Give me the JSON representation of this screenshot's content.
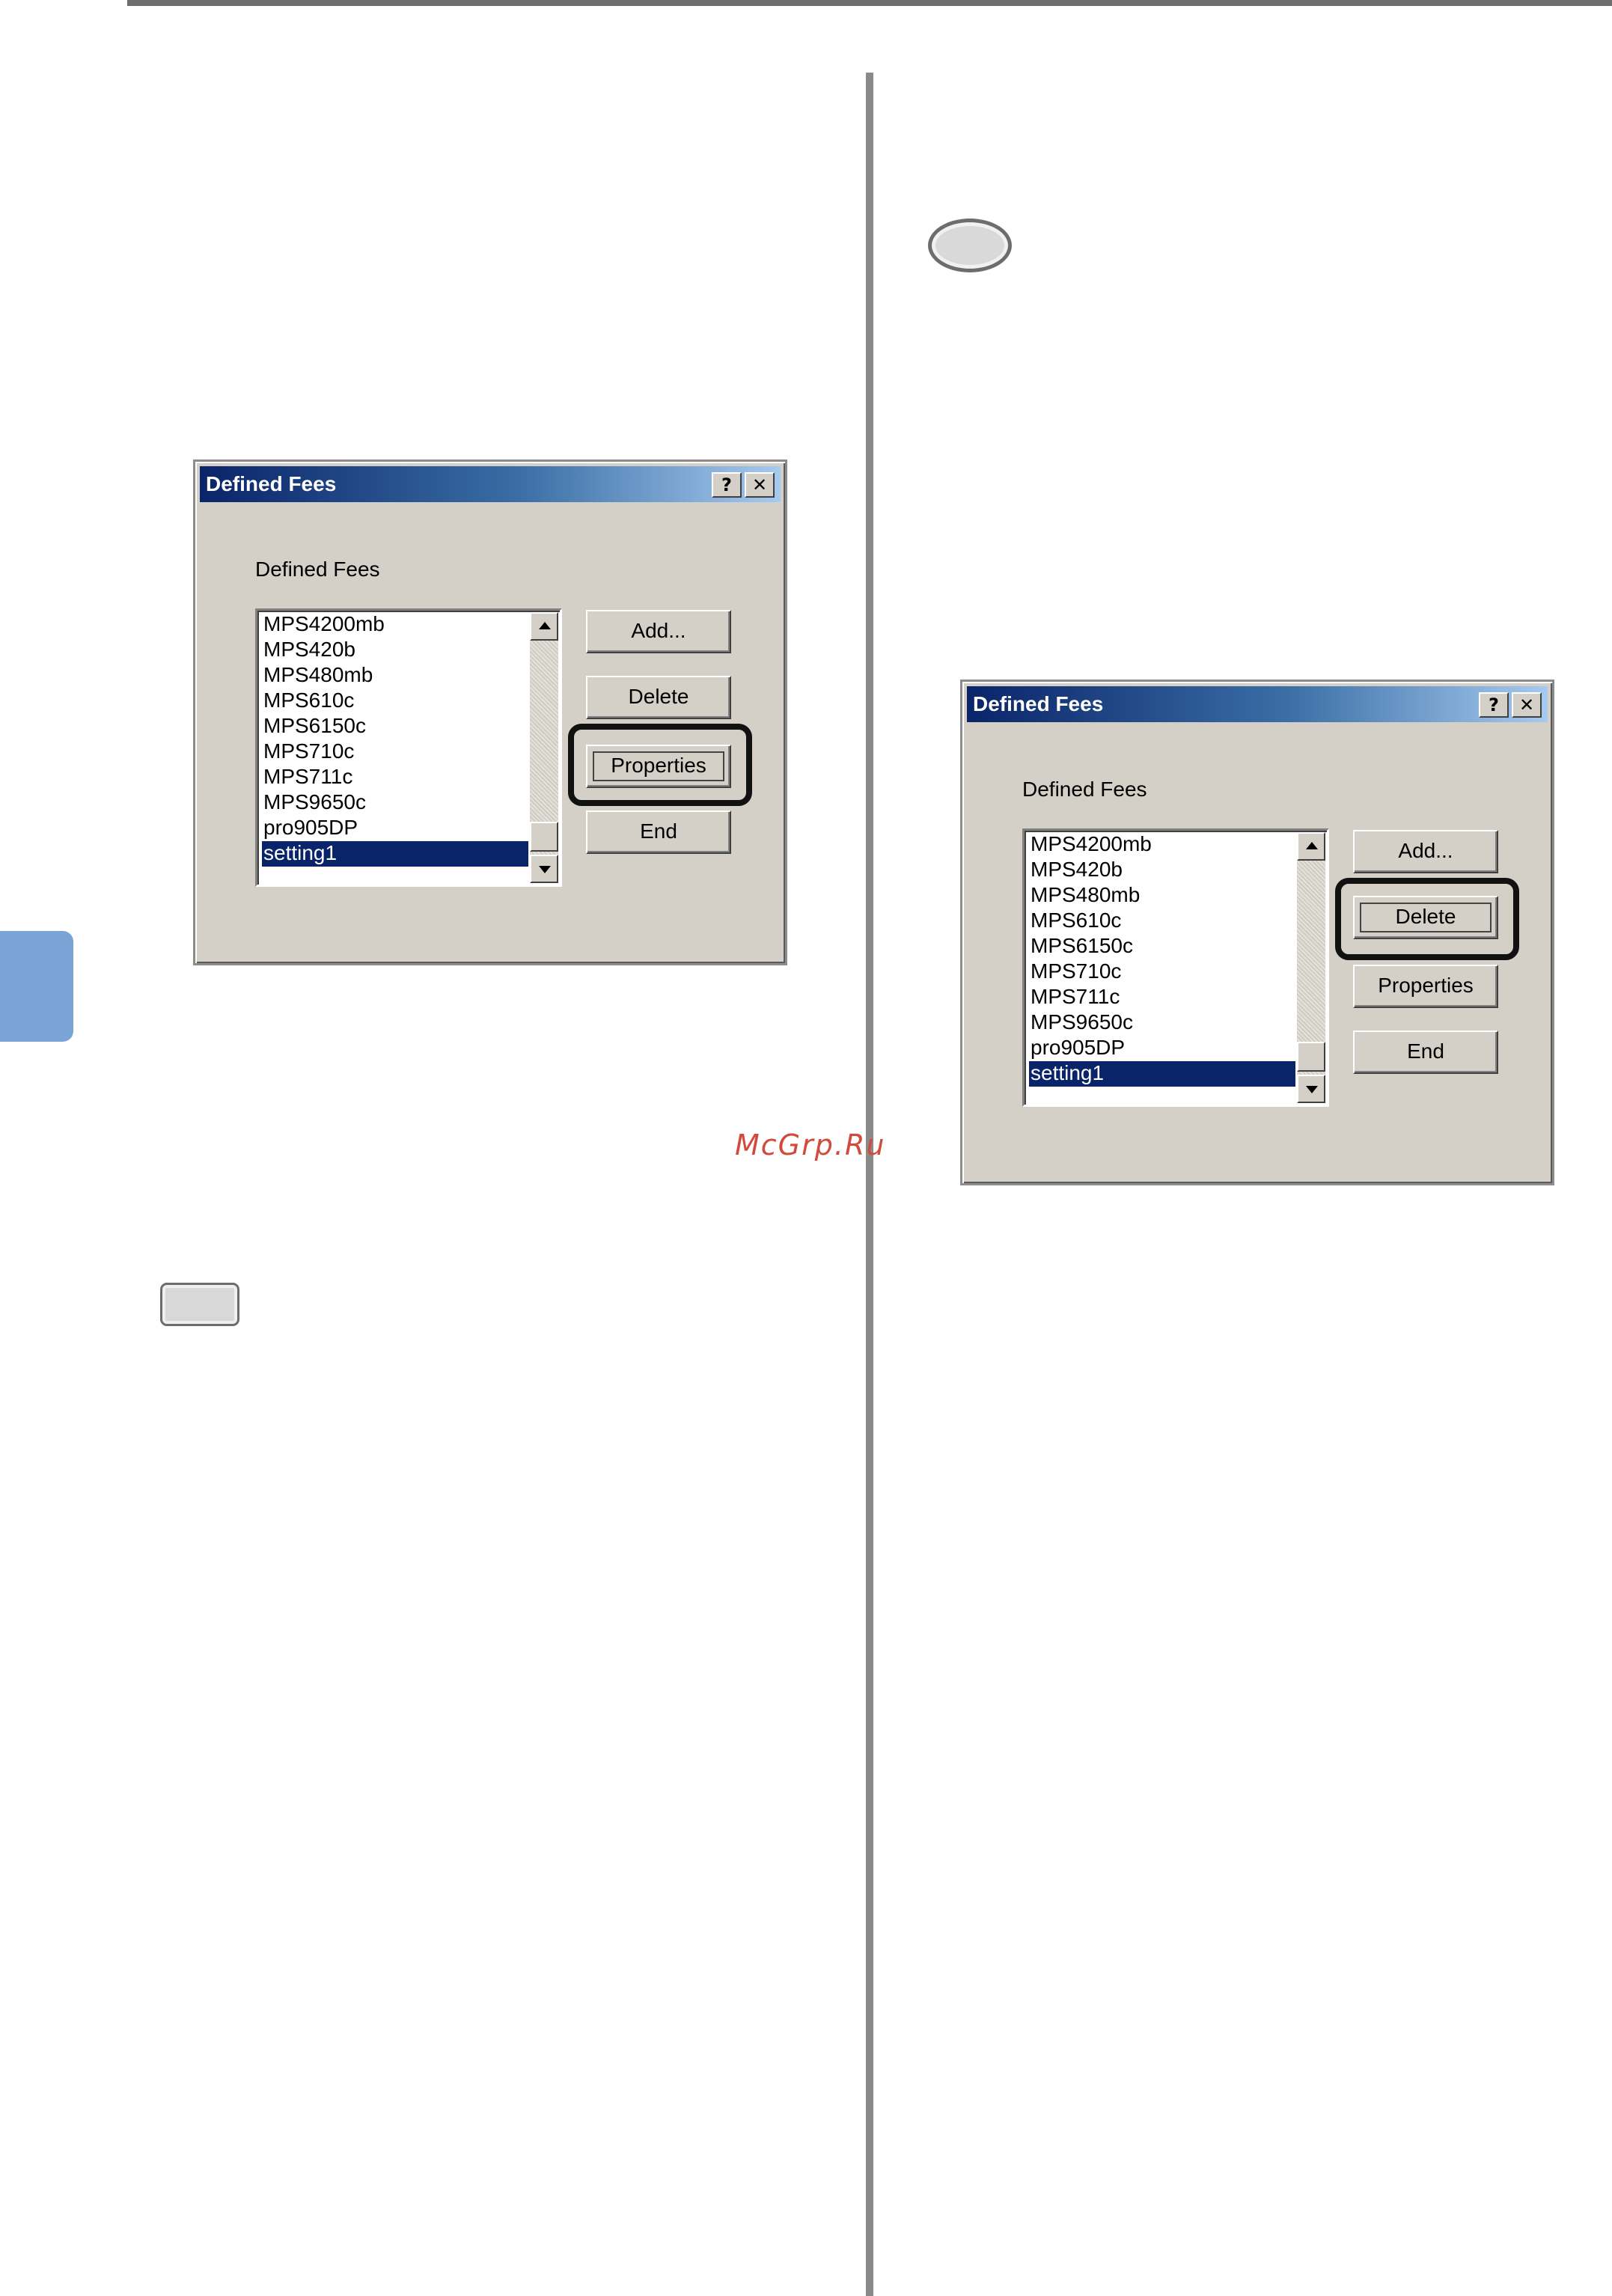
{
  "watermark": "McGrp.Ru",
  "dialogs": [
    {
      "title": "Defined Fees",
      "help_glyph": "?",
      "close_glyph": "✕",
      "group_label": "Defined Fees",
      "items": [
        "MPS4200mb",
        "MPS420b",
        "MPS480mb",
        "MPS610c",
        "MPS6150c",
        "MPS710c",
        "MPS711c",
        "MPS9650c",
        "pro905DP",
        "setting1"
      ],
      "selected": "setting1",
      "buttons": {
        "add": "Add...",
        "delete": "Delete",
        "properties": "Properties",
        "end": "End"
      },
      "highlighted_button": "Properties"
    },
    {
      "title": "Defined Fees",
      "help_glyph": "?",
      "close_glyph": "✕",
      "group_label": "Defined Fees",
      "items": [
        "MPS4200mb",
        "MPS420b",
        "MPS480mb",
        "MPS610c",
        "MPS6150c",
        "MPS710c",
        "MPS711c",
        "MPS9650c",
        "pro905DP",
        "setting1"
      ],
      "selected": "setting1",
      "buttons": {
        "add": "Add...",
        "delete": "Delete",
        "properties": "Properties",
        "end": "End"
      },
      "highlighted_button": "Delete"
    }
  ]
}
